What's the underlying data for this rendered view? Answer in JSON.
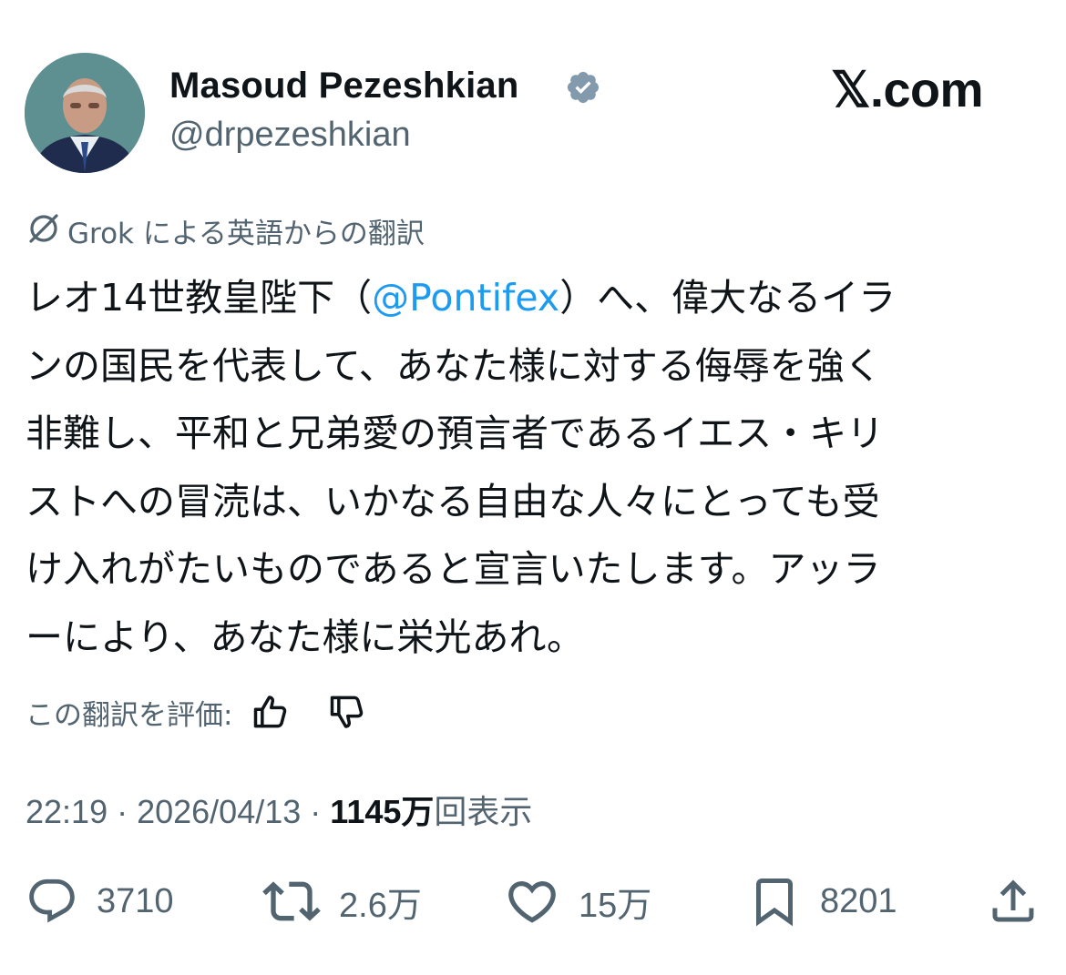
{
  "author": {
    "name": "Masoud Pezeshkian",
    "handle": "@drpezeshkian",
    "verified_badge_color": "#829aab"
  },
  "site_logo": "𝕏.com",
  "translation": {
    "label": "Grok による英語からの翻訳"
  },
  "tweet": {
    "lines": [
      {
        "before": "レオ14世教皇陛下（",
        "mention": "@Pontifex",
        "after": "）へ、偉大なるイラ"
      },
      {
        "text": "ンの国民を代表して、あなた様に対する侮辱を強く"
      },
      {
        "text": "非難し、平和と兄弟愛の預言者であるイエス・キリ"
      },
      {
        "text": "ストへの冒涜は、いかなる自由な人々にとっても受"
      },
      {
        "text": "け入れがたいものであると宣言いたします。アッラ"
      },
      {
        "text": "ーにより、あなた様に栄光あれ。"
      }
    ],
    "mention_color": "#1d9bf0"
  },
  "rate": {
    "label": "この翻訳を評価:"
  },
  "meta": {
    "time": "22:19",
    "separator": " · ",
    "date": "2026/04/13",
    "views_count": "1145万",
    "views_label": "回表示"
  },
  "actions": {
    "replies": "3710",
    "reposts": "2.6万",
    "likes": "15万",
    "bookmarks": "8201"
  },
  "colors": {
    "text": "#0f1419",
    "secondary": "#536471",
    "link": "#1d9bf0"
  }
}
